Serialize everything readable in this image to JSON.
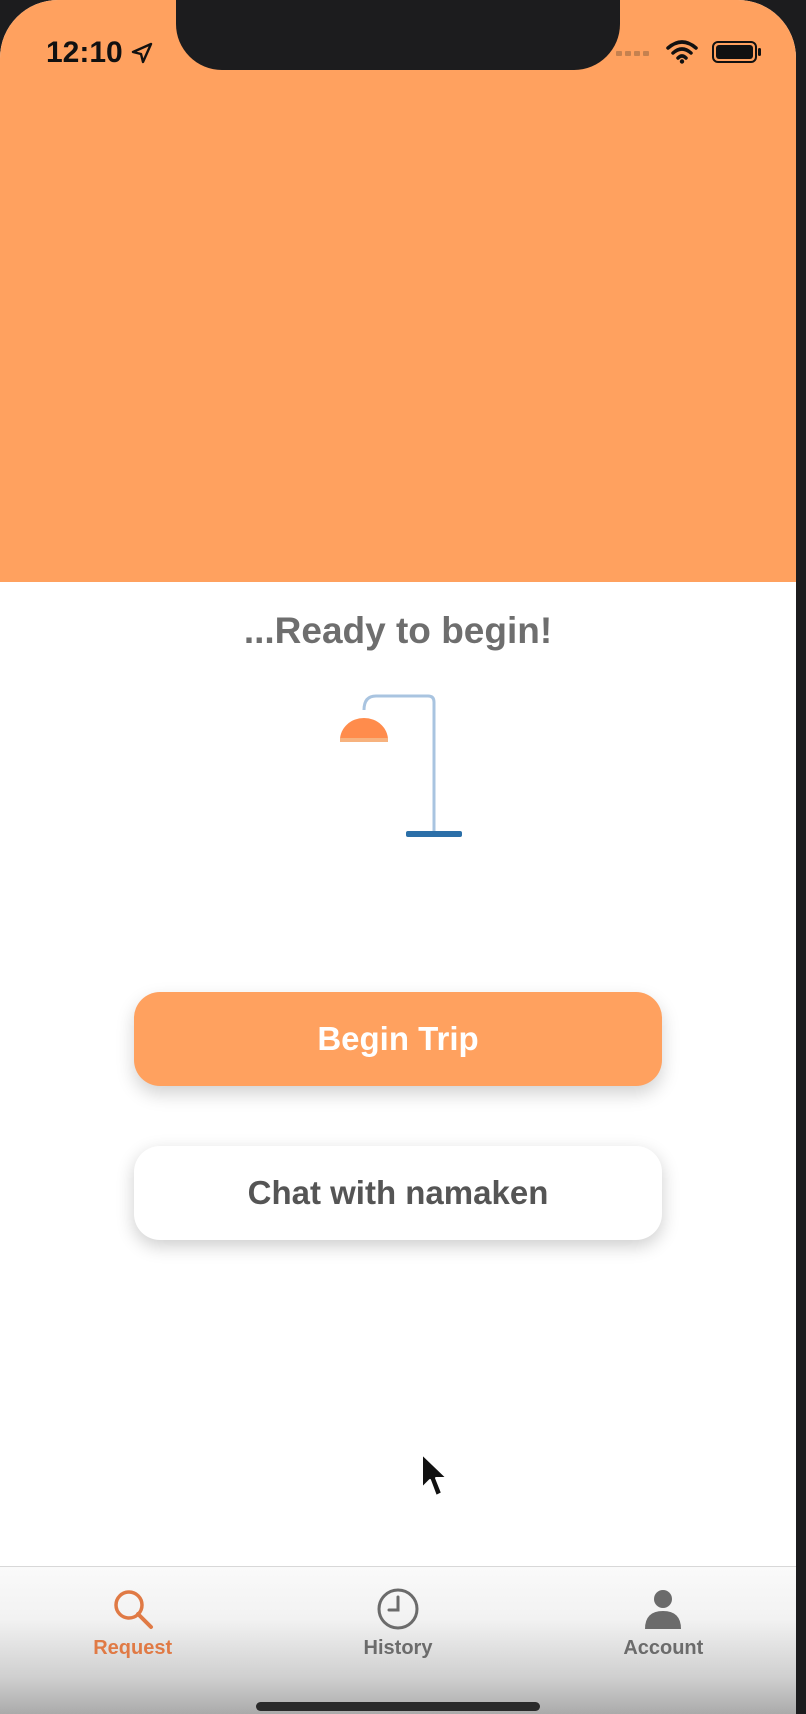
{
  "status_bar": {
    "time": "12:10",
    "icons": [
      "location-arrow-icon",
      "cellular-signal-icon",
      "wifi-icon",
      "battery-icon"
    ]
  },
  "colors": {
    "accent": "#ffa15f",
    "active_tab": "#e07a45",
    "text_gray": "#6e6e6e"
  },
  "main": {
    "title": "...Ready to begin!",
    "illustration": "floor-lamp-icon"
  },
  "buttons": {
    "begin_trip": "Begin Trip",
    "chat": "Chat with namaken"
  },
  "tabbar": {
    "active": "Request",
    "tabs": [
      {
        "label": "Request",
        "icon": "search-icon"
      },
      {
        "label": "History",
        "icon": "clock-icon"
      },
      {
        "label": "Account",
        "icon": "person-icon"
      }
    ]
  }
}
